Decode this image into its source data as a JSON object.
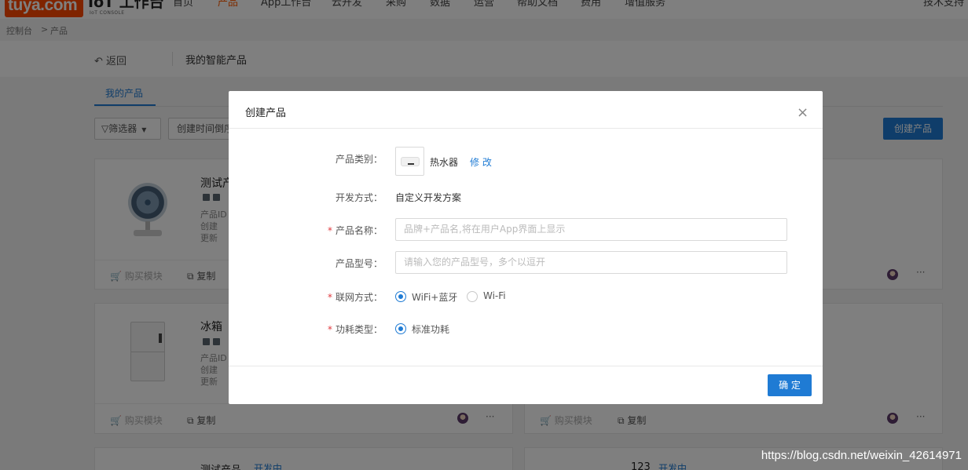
{
  "nav": {
    "logo": "tuya.com",
    "brand": "IoT 工作台",
    "brand_sub": "IoT CONSOLE",
    "items": [
      "首页",
      "产品",
      "App工作台",
      "云开发",
      "采购",
      "数据",
      "运营",
      "帮助文档",
      "费用",
      "增值服务"
    ],
    "right": "技术支持"
  },
  "breadcrumb": {
    "home": "控制台",
    "sep": ">",
    "current": "产品"
  },
  "page": {
    "back": "返回",
    "title": "我的智能产品",
    "tab": "我的产品",
    "filter": "筛选器",
    "sort": "创建时间倒序",
    "create_button": "创建产品"
  },
  "cards": [
    {
      "name": "测试产品",
      "fields": [
        "产品ID",
        "创建",
        "更新"
      ],
      "buy": "购买模块",
      "copy": "复制",
      "more": "···"
    },
    {
      "name": "冰箱",
      "fields": [
        "产品ID",
        "创建",
        "更新"
      ],
      "buy": "购买模块",
      "copy": "复制",
      "more": "···"
    },
    {
      "name": "测试产品",
      "status": "开发中"
    },
    {
      "name": "123",
      "status": "开发中"
    }
  ],
  "right_cards": [
    {
      "buy": "购买模块",
      "copy": "复制",
      "more": "···"
    }
  ],
  "modal": {
    "title": "创建产品",
    "close_glyph": "×",
    "category_label": "产品类别：",
    "category_value": "热水器",
    "category_edit": "修 改",
    "dev_label": "开发方式：",
    "dev_value": "自定义开发方案",
    "name_label": "产品名称：",
    "name_placeholder": "品牌+产品名,将在用户App界面上显示",
    "model_label": "产品型号：",
    "model_placeholder": "请输入您的产品型号，多个以逗开",
    "network_label": "联网方式：",
    "network_options": [
      "WiFi+蓝牙",
      "Wi-Fi"
    ],
    "network_selected": "WiFi+蓝牙",
    "power_label": "功耗类型：",
    "power_options": [
      "标准功耗"
    ],
    "power_selected": "标准功耗",
    "required_mark": "*",
    "confirm": "确 定"
  },
  "watermark": "https://blog.csdn.net/weixin_42614971",
  "colors": {
    "accent": "#1f7bd4",
    "brand": "#ff4800",
    "nav_active": "#ff5a00",
    "required": "#e0393e"
  }
}
